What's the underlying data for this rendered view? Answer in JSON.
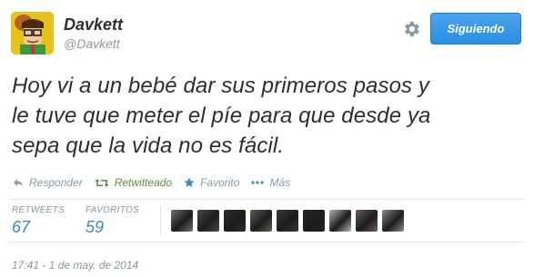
{
  "user": {
    "display_name": "Davkett",
    "handle": "@Davkett"
  },
  "follow_button": {
    "label": "Siguiendo"
  },
  "tweet": {
    "lines": [
      "Hoy vi a un bebé dar sus primeros pasos y",
      "le tuve que meter el píe para que desde ya",
      "sepa que la vida no es fácil."
    ]
  },
  "actions": {
    "reply": "Responder",
    "retweet": "Retwitteado",
    "favorite": "Favorito",
    "more": "Más"
  },
  "stats": {
    "retweets_label": "RETWEETS",
    "retweets_value": "67",
    "favorites_label": "FAVORITOS",
    "favorites_value": "59"
  },
  "favoriters": [
    {
      "name": "favoriter-1",
      "color": "#6f6f6f"
    },
    {
      "name": "favoriter-2",
      "color": "#4a4a4a"
    },
    {
      "name": "favoriter-3",
      "color": "#2f2a2c"
    },
    {
      "name": "favoriter-4",
      "color": "#5a6052"
    },
    {
      "name": "favoriter-5",
      "color": "#3a3636"
    },
    {
      "name": "favoriter-6",
      "color": "#242424"
    },
    {
      "name": "favoriter-7",
      "color": "#b7b2b5"
    },
    {
      "name": "favoriter-8",
      "color": "#6d5a5f"
    },
    {
      "name": "favoriter-9",
      "color": "#8a8a8a"
    }
  ],
  "timestamp": "17:41 - 1 de may. de 2014",
  "colors": {
    "accent": "#3b88c3",
    "retweeted": "#5c913b",
    "muted": "#8899a6",
    "button": "#2a8ee0"
  },
  "icons": {
    "avatar": "cartoon-avatar-icon",
    "settings": "gear-icon",
    "reply": "reply-icon",
    "retweet": "retweet-icon",
    "favorite": "star-icon",
    "more": "more-dots-icon"
  }
}
